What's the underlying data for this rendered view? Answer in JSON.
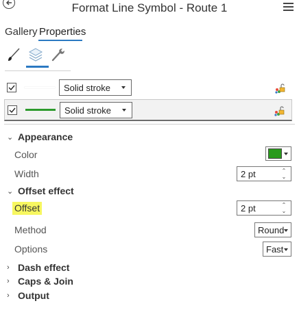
{
  "header": {
    "title": "Format Line Symbol - Route 1",
    "back_icon": "back-arrow-icon",
    "menu_icon": "hamburger-menu-icon"
  },
  "tabs": [
    {
      "label": "Gallery",
      "active": false
    },
    {
      "label": "Properties",
      "active": true
    }
  ],
  "tools": [
    {
      "name": "brush-icon",
      "active": false
    },
    {
      "name": "layers-icon",
      "active": true
    },
    {
      "name": "wrench-icon",
      "active": false
    }
  ],
  "layers": [
    {
      "checked": true,
      "stroke_type": "Solid stroke",
      "line_color": "#ffffff",
      "selected": false
    },
    {
      "checked": true,
      "stroke_type": "Solid stroke",
      "line_color": "#2c9a2c",
      "selected": true
    }
  ],
  "appearance": {
    "heading": "Appearance",
    "color_label": "Color",
    "color_value": "#2a9a1c",
    "width_label": "Width",
    "width_value": "2 pt"
  },
  "offset_effect": {
    "heading": "Offset effect",
    "offset_label": "Offset",
    "offset_value": "2 pt",
    "method_label": "Method",
    "method_value": "Round",
    "options_label": "Options",
    "options_value": "Fast"
  },
  "collapsed_sections": [
    "Dash effect",
    "Caps & Join",
    "Output"
  ],
  "colors": {
    "accent": "#2b79c2",
    "highlight": "#f7f760"
  }
}
